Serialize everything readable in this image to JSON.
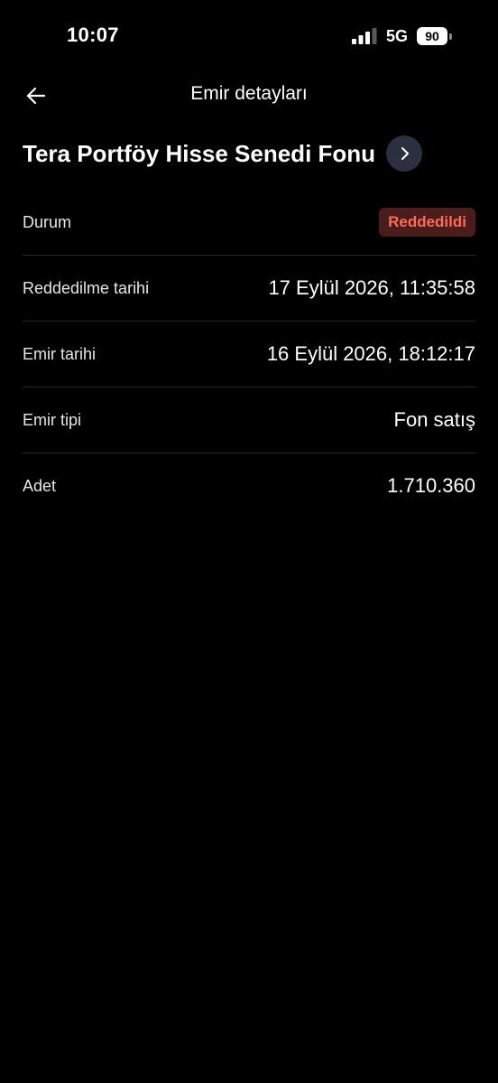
{
  "status_bar": {
    "time": "10:07",
    "network": "5G",
    "battery": "90",
    "icons": [
      "signal-icon",
      "battery-icon"
    ]
  },
  "header": {
    "title": "Emir detayları",
    "back_icon": "arrow-left-icon"
  },
  "fund": {
    "name": "Tera Portföy Hisse Senedi Fonu",
    "link_icon": "chevron-right-icon"
  },
  "details": {
    "status": {
      "label": "Durum",
      "value": "Reddedildi",
      "badge_color": "#ff6b57",
      "badge_bg": "#4a1c1c"
    },
    "rejected_date": {
      "label": "Reddedilme tarihi",
      "value": "17 Eylül 2026, 11:35:58"
    },
    "order_date": {
      "label": "Emir tarihi",
      "value": "16 Eylül 2026, 18:12:17"
    },
    "order_type": {
      "label": "Emir tipi",
      "value": "Fon satış"
    },
    "quantity": {
      "label": "Adet",
      "value": "1.710.360"
    }
  },
  "colors": {
    "background": "#000000",
    "divider": "#262626",
    "fund_button_bg": "#2c2f3f"
  }
}
